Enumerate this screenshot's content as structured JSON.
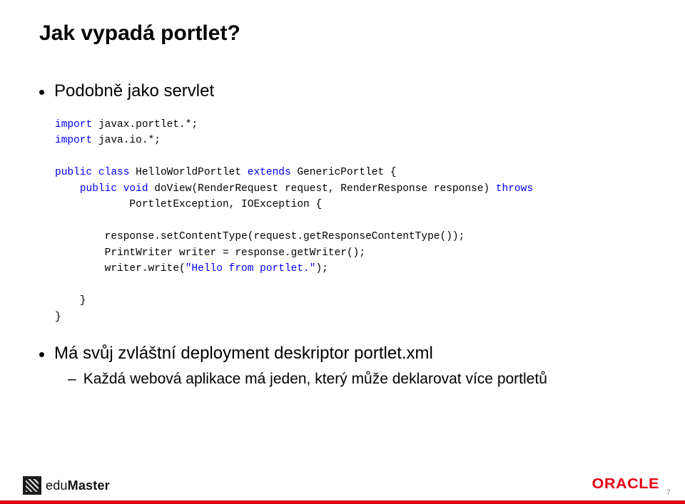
{
  "title": "Jak vypadá portlet?",
  "bullet1": "Podobně jako servlet",
  "code": {
    "l1a": "import",
    "l1b": " javax.portlet.*;",
    "l2a": "import",
    "l2b": " java.io.*;",
    "l3a": "public",
    "l3b": " ",
    "l3c": "class",
    "l3d": " HelloWorldPortlet ",
    "l3e": "extends",
    "l3f": " GenericPortlet {",
    "l4a": "    ",
    "l4b": "public",
    "l4c": " ",
    "l4d": "void",
    "l4e": " doView(RenderRequest request, RenderResponse response) ",
    "l4f": "throws",
    "l5": "            PortletException, IOException {",
    "l6": "        response.setContentType(request.getResponseContentType());",
    "l7": "        PrintWriter writer = response.getWriter();",
    "l8a": "        writer.write(",
    "l8b": "\"Hello from portlet.\"",
    "l8c": ");",
    "l9": "    }",
    "l10": "}"
  },
  "bullet2": "Má svůj zvláštní deployment deskriptor portlet.xml",
  "sub1": "Každá webová aplikace má jeden, který může deklarovat více portletů",
  "footer": {
    "brand_plain1": "edu",
    "brand_bold": "Master",
    "oracle": "ORACLE",
    "page": "7"
  }
}
